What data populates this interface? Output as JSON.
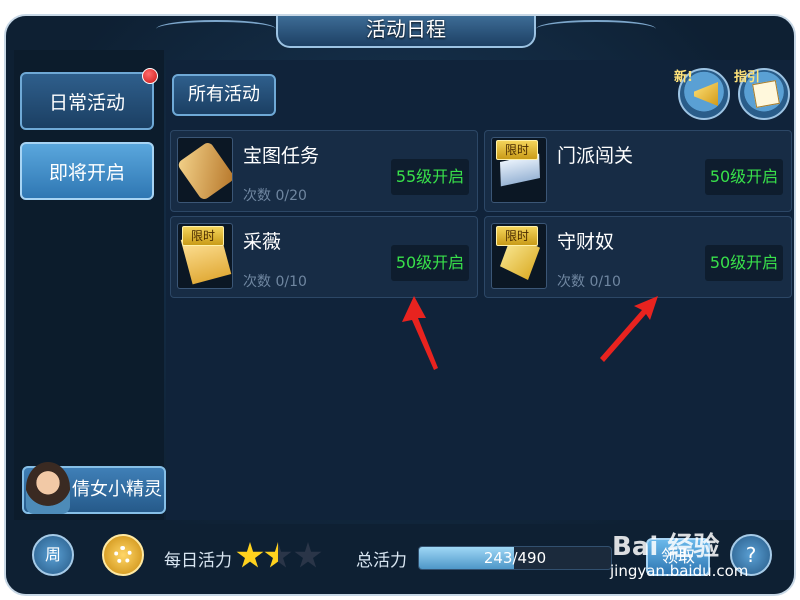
{
  "window": {
    "title": "活动日程"
  },
  "sidebar": {
    "tabs": [
      {
        "label": "日常活动",
        "has_badge": true
      },
      {
        "label": "即将开启",
        "selected": true
      }
    ],
    "spirit_button": {
      "label": "倩女小精灵"
    }
  },
  "content": {
    "filter_tab": "所有活动",
    "top_icons": [
      {
        "name": "new-icon",
        "tag": "新!"
      },
      {
        "name": "guide-icon",
        "tag": "指引"
      }
    ],
    "activities": [
      {
        "name": "宝图任务",
        "count": "次数 0/20",
        "level": "55级开启",
        "limited": false,
        "icon": "scroll-icon"
      },
      {
        "name": "门派闯关",
        "count": "",
        "level": "50级开启",
        "limited": true,
        "limited_label": "限时",
        "icon": "brick-icon"
      },
      {
        "name": "采薇",
        "count": "次数 0/10",
        "level": "50级开启",
        "limited": true,
        "limited_label": "限时",
        "icon": "letter-icon"
      },
      {
        "name": "守财奴",
        "count": "次数 0/10",
        "level": "50级开启",
        "limited": true,
        "limited_label": "限时",
        "icon": "crystal-icon"
      }
    ]
  },
  "bottom_bar": {
    "week_label": "周",
    "daily_vitality_label": "每日活力",
    "daily_rating_stars": 1.5,
    "daily_rating_max": 3,
    "total_vitality_label": "总活力",
    "vitality_text": "243/490",
    "vitality_fraction": 0.496,
    "redeem_label": "领取",
    "help_label": "?"
  },
  "watermark": {
    "text": "Bai 经验",
    "url": "jingyan.baidu.com"
  },
  "colors": {
    "level_green": "#38e04a",
    "limit_gold": "#f4d45a",
    "arrow_red": "#e8231f",
    "badge_red": "#c91616"
  }
}
